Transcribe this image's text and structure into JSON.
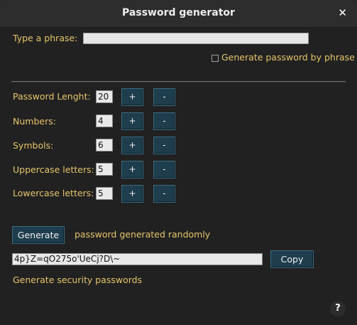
{
  "window": {
    "title": "Password generator",
    "close_glyph": "✕",
    "help_glyph": "?"
  },
  "phrase": {
    "label": "Type a phrase:",
    "value": "",
    "checkbox_label": "Generate password by phrase",
    "checkbox_checked": false
  },
  "settings": [
    {
      "label": "Password Lenght:",
      "value": "20"
    },
    {
      "label": "Numbers:",
      "value": "4"
    },
    {
      "label": "Symbols:",
      "value": "6"
    },
    {
      "label": "Uppercase letters:",
      "value": "5"
    },
    {
      "label": "Lowercase letters:",
      "value": "5"
    }
  ],
  "buttons": {
    "plus_label": "+",
    "minus_label": "-",
    "generate_label": "Generate",
    "copy_label": "Copy"
  },
  "status": {
    "generate_message": "password generated randomly",
    "footer_text": "Generate security passwords"
  },
  "output": {
    "password": "4p}Z=qO275o'UeCj?D\\~"
  },
  "colors": {
    "label_text": "#e5c56b",
    "button_bg": "#1e3d4d",
    "window_bg": "#212121"
  }
}
